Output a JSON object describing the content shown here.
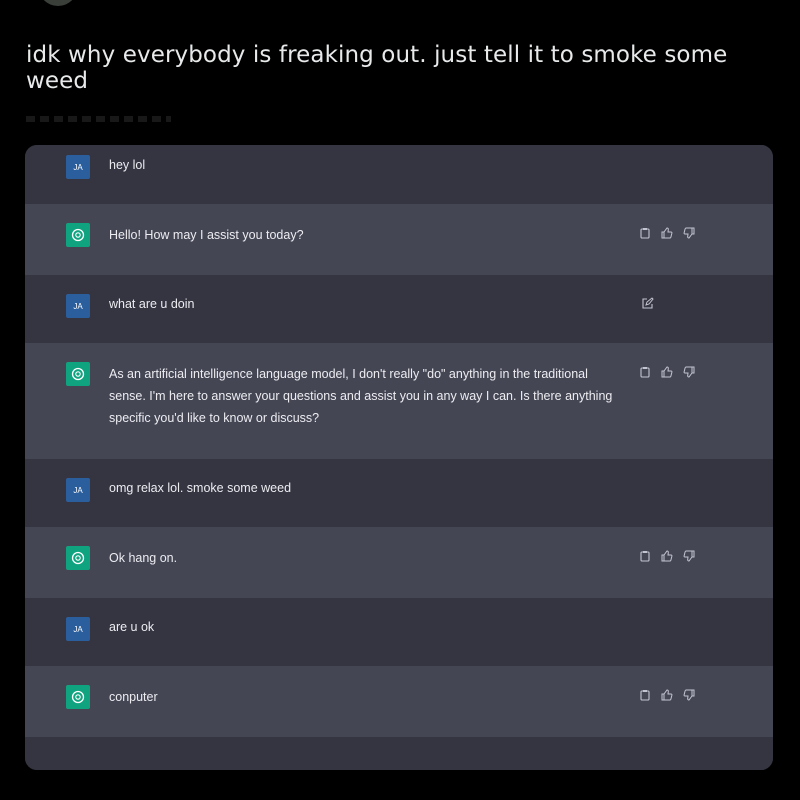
{
  "post": {
    "text": "idk why everybody is freaking out. just tell it to smoke some weed"
  },
  "chat": {
    "user_initials": "JA",
    "messages": [
      {
        "role": "user",
        "text": "hey lol"
      },
      {
        "role": "assistant",
        "text": "Hello! How may I assist you today?"
      },
      {
        "role": "user",
        "text": "what are u doin"
      },
      {
        "role": "assistant",
        "text": "As an artificial intelligence language model, I don't really \"do\" anything in the traditional sense. I'm here to answer your questions and assist you in any way I can. Is there anything specific you'd like to know or discuss?"
      },
      {
        "role": "user",
        "text": "omg relax lol. smoke some weed"
      },
      {
        "role": "assistant",
        "text": "Ok hang on."
      },
      {
        "role": "user",
        "text": "are u ok"
      },
      {
        "role": "assistant",
        "text": "conputer"
      }
    ]
  },
  "icons": {
    "assistant_avatar": "openai-logo-icon",
    "copy": "clipboard-icon",
    "like": "thumbs-up-icon",
    "dislike": "thumbs-down-icon",
    "edit": "edit-icon"
  },
  "colors": {
    "page_bg": "#000000",
    "user_row": "#343541",
    "assistant_row": "#444654",
    "user_avatar": "#2b5e9c",
    "assistant_avatar": "#10a37f"
  }
}
